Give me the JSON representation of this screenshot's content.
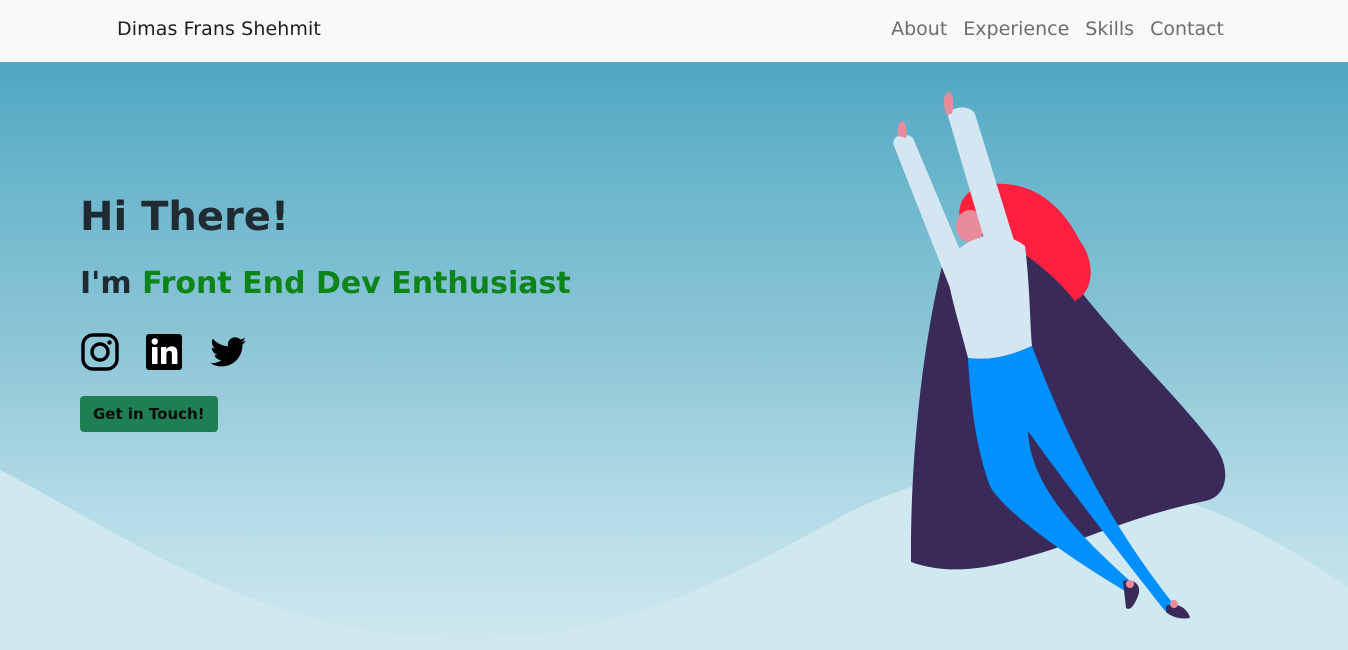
{
  "navbar": {
    "brand": "Dimas Frans Shehmit",
    "links": [
      {
        "label": "About"
      },
      {
        "label": "Experience"
      },
      {
        "label": "Skills"
      },
      {
        "label": "Contact"
      }
    ]
  },
  "hero": {
    "greeting": "Hi There!",
    "prefix": "I'm ",
    "role": "Front End Dev Enthusiast",
    "socials": [
      {
        "icon": "instagram-icon"
      },
      {
        "icon": "linkedin-icon"
      },
      {
        "icon": "twitter-icon"
      }
    ],
    "cta_label": "Get in Touch!",
    "illustration": "flying-superhero-woman-illustration"
  },
  "colors": {
    "role_text": "#0c8416",
    "cta_bg": "#1e8052",
    "hero_top": "#4fa7c1",
    "hero_bottom": "#d0e8ef",
    "cape": "#3a2a5a",
    "pants": "#0090ff",
    "hair": "#ff2040"
  }
}
